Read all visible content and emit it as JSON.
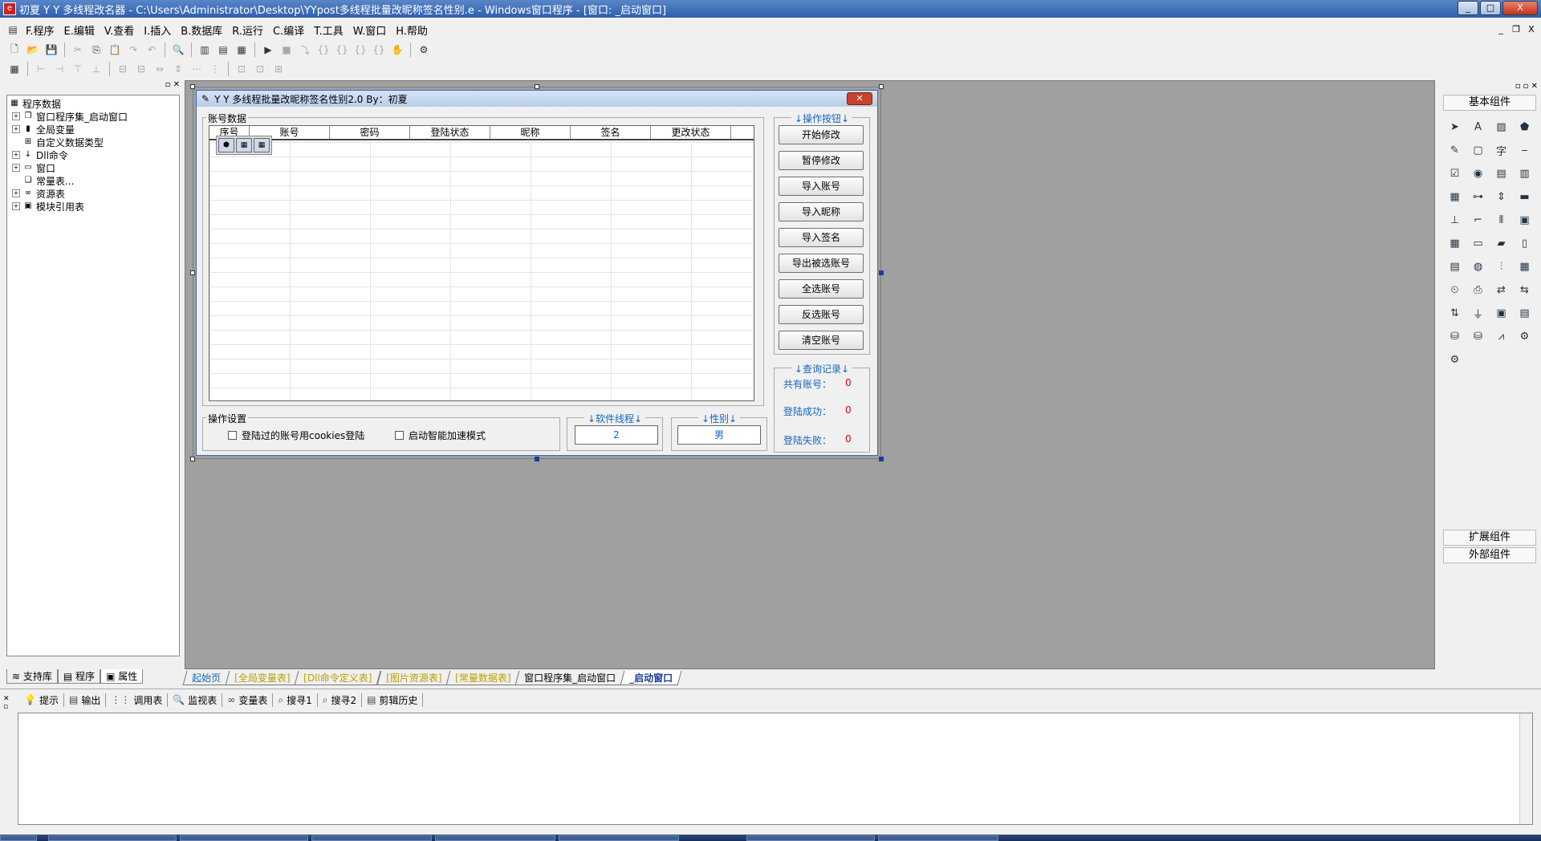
{
  "window": {
    "title": "初夏 Y Y 多线程改名器 - C:\\Users\\Administrator\\Desktop\\YYpost多线程批量改昵称签名性别.e - Windows窗口程序 - [窗口: _启动窗口]",
    "app_icon": "e-language-icon",
    "controls": {
      "minimize": "_",
      "maximize": "□",
      "close": "X"
    }
  },
  "menu": [
    {
      "label": "F.程序"
    },
    {
      "label": "E.编辑"
    },
    {
      "label": "V.查看"
    },
    {
      "label": "I.插入"
    },
    {
      "label": "B.数据库"
    },
    {
      "label": "R.运行"
    },
    {
      "label": "C.编译"
    },
    {
      "label": "T.工具"
    },
    {
      "label": "W.窗口"
    },
    {
      "label": "H.帮助"
    }
  ],
  "mdi_controls": {
    "minimize": "_",
    "restore": "❐",
    "close": "X"
  },
  "left_panel": {
    "tree": [
      {
        "label": "程序数据",
        "expand": ""
      },
      {
        "label": "窗口程序集_启动窗口",
        "expand": "+"
      },
      {
        "label": "全局变量",
        "expand": "+"
      },
      {
        "label": "自定义数据类型",
        "expand": ""
      },
      {
        "label": "Dll命令",
        "expand": "+"
      },
      {
        "label": "窗口",
        "expand": "+"
      },
      {
        "label": "常量表...",
        "expand": ""
      },
      {
        "label": "资源表",
        "expand": "+"
      },
      {
        "label": "模块引用表",
        "expand": "+"
      }
    ],
    "tabs": [
      "支持库",
      "程序",
      "属性"
    ]
  },
  "form": {
    "title": "Y Y 多线程批量改昵称签名性别2.0    By：初夏",
    "account_group": "账号数据",
    "columns": [
      "序号",
      "账号",
      "密码",
      "登陆状态",
      "昵称",
      "签名",
      "更改状态"
    ],
    "ops_group": "↓操作按钮↓",
    "buttons": [
      "开始修改",
      "暂停修改",
      "导入账号",
      "导入昵称",
      "导入签名",
      "导出被选账号",
      "全选账号",
      "反选账号",
      "清空账号"
    ],
    "settings_group": "操作设置",
    "checkbox_cookies": "登陆过的账号用cookies登陆",
    "checkbox_speed": "启动智能加速模式",
    "threads_group": "↓软件线程↓",
    "threads_value": "2",
    "gender_group": "↓性别↓",
    "gender_value": "男",
    "query_group": "↓查询记录↓",
    "stats": [
      {
        "label": "共有账号：",
        "value": "0"
      },
      {
        "label": "登陆成功：",
        "value": "0"
      },
      {
        "label": "登陆失败：",
        "value": "0"
      }
    ]
  },
  "right_panel": {
    "title": "基本组件",
    "footer1": "扩展组件",
    "footer2": "外部组件"
  },
  "doc_tabs": [
    {
      "label": "起始页"
    },
    {
      "label": "[全局变量表]"
    },
    {
      "label": "[Dll命令定义表]"
    },
    {
      "label": "[图片资源表]"
    },
    {
      "label": "[常量数据表]"
    },
    {
      "label": "窗口程序集_启动窗口"
    },
    {
      "label": "_启动窗口"
    }
  ],
  "bottom_tabs": [
    "提示",
    "输出",
    "调用表",
    "监视表",
    "变量表",
    "搜寻1",
    "搜寻2",
    "剪辑历史"
  ],
  "colors": {
    "accent": "#1565c0",
    "stat_value": "#dd0000",
    "workspace": "#a0a0a0"
  }
}
